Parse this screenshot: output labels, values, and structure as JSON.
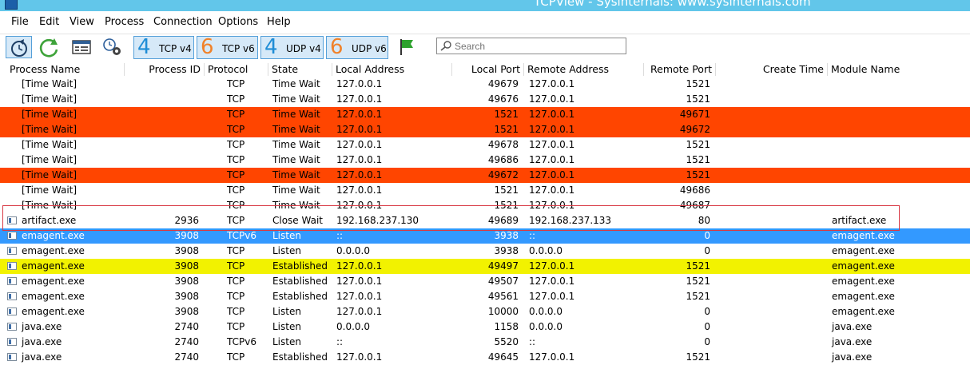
{
  "window": {
    "title": "TCPView - Sysinternals: www.sysinternals.com"
  },
  "menu": [
    "File",
    "Edit",
    "View",
    "Process",
    "Connection",
    "Options",
    "Help"
  ],
  "toolbar": {
    "protocols": [
      {
        "num": "4",
        "label": "TCP v4",
        "color": "#1f8dd6"
      },
      {
        "num": "6",
        "label": "TCP v6",
        "color": "#f0822a"
      },
      {
        "num": "4",
        "label": "UDP v4",
        "color": "#1f8dd6"
      },
      {
        "num": "6",
        "label": "UDP v6",
        "color": "#f0822a"
      }
    ]
  },
  "search": {
    "placeholder": "Search"
  },
  "columns": [
    "Process Name",
    "Process ID",
    "Protocol",
    "State",
    "Local Address",
    "Local Port",
    "Remote Address",
    "Remote Port",
    "Create Time",
    "Module Name"
  ],
  "colors": {
    "removed": "#ff4500",
    "new": "#3399ff",
    "changed": "#f2f200",
    "highlight_box": "#d83a45"
  },
  "rows": [
    {
      "name": "[Time Wait]",
      "pid": "",
      "proto": "TCP",
      "state": "Time Wait",
      "laddr": "127.0.0.1",
      "lport": "49679",
      "raddr": "127.0.0.1",
      "rport": "1521",
      "ctime": "",
      "module": "",
      "status": "normal",
      "icon": false
    },
    {
      "name": "[Time Wait]",
      "pid": "",
      "proto": "TCP",
      "state": "Time Wait",
      "laddr": "127.0.0.1",
      "lport": "49676",
      "raddr": "127.0.0.1",
      "rport": "1521",
      "ctime": "",
      "module": "",
      "status": "normal",
      "icon": false
    },
    {
      "name": "[Time Wait]",
      "pid": "",
      "proto": "TCP",
      "state": "Time Wait",
      "laddr": "127.0.0.1",
      "lport": "1521",
      "raddr": "127.0.0.1",
      "rport": "49671",
      "ctime": "",
      "module": "",
      "status": "removed",
      "icon": false
    },
    {
      "name": "[Time Wait]",
      "pid": "",
      "proto": "TCP",
      "state": "Time Wait",
      "laddr": "127.0.0.1",
      "lport": "1521",
      "raddr": "127.0.0.1",
      "rport": "49672",
      "ctime": "",
      "module": "",
      "status": "removed",
      "icon": false
    },
    {
      "name": "[Time Wait]",
      "pid": "",
      "proto": "TCP",
      "state": "Time Wait",
      "laddr": "127.0.0.1",
      "lport": "49678",
      "raddr": "127.0.0.1",
      "rport": "1521",
      "ctime": "",
      "module": "",
      "status": "normal",
      "icon": false
    },
    {
      "name": "[Time Wait]",
      "pid": "",
      "proto": "TCP",
      "state": "Time Wait",
      "laddr": "127.0.0.1",
      "lport": "49686",
      "raddr": "127.0.0.1",
      "rport": "1521",
      "ctime": "",
      "module": "",
      "status": "normal",
      "icon": false
    },
    {
      "name": "[Time Wait]",
      "pid": "",
      "proto": "TCP",
      "state": "Time Wait",
      "laddr": "127.0.0.1",
      "lport": "49672",
      "raddr": "127.0.0.1",
      "rport": "1521",
      "ctime": "",
      "module": "",
      "status": "removed",
      "icon": false
    },
    {
      "name": "[Time Wait]",
      "pid": "",
      "proto": "TCP",
      "state": "Time Wait",
      "laddr": "127.0.0.1",
      "lport": "1521",
      "raddr": "127.0.0.1",
      "rport": "49686",
      "ctime": "",
      "module": "",
      "status": "normal",
      "icon": false
    },
    {
      "name": "[Time Wait]",
      "pid": "",
      "proto": "TCP",
      "state": "Time Wait",
      "laddr": "127.0.0.1",
      "lport": "1521",
      "raddr": "127.0.0.1",
      "rport": "49687",
      "ctime": "",
      "module": "",
      "status": "normal",
      "icon": false
    },
    {
      "name": "artifact.exe",
      "pid": "2936",
      "proto": "TCP",
      "state": "Close Wait",
      "laddr": "192.168.237.130",
      "lport": "49689",
      "raddr": "192.168.237.133",
      "rport": "80",
      "ctime": "",
      "module": "artifact.exe",
      "status": "normal",
      "icon": true
    },
    {
      "name": "emagent.exe",
      "pid": "3908",
      "proto": "TCPv6",
      "state": "Listen",
      "laddr": "::",
      "lport": "3938",
      "raddr": "::",
      "rport": "0",
      "ctime": "",
      "module": "emagent.exe",
      "status": "new",
      "icon": true
    },
    {
      "name": "emagent.exe",
      "pid": "3908",
      "proto": "TCP",
      "state": "Listen",
      "laddr": "0.0.0.0",
      "lport": "3938",
      "raddr": "0.0.0.0",
      "rport": "0",
      "ctime": "",
      "module": "emagent.exe",
      "status": "normal",
      "icon": true
    },
    {
      "name": "emagent.exe",
      "pid": "3908",
      "proto": "TCP",
      "state": "Established",
      "laddr": "127.0.0.1",
      "lport": "49497",
      "raddr": "127.0.0.1",
      "rport": "1521",
      "ctime": "",
      "module": "emagent.exe",
      "status": "changed",
      "icon": true
    },
    {
      "name": "emagent.exe",
      "pid": "3908",
      "proto": "TCP",
      "state": "Established",
      "laddr": "127.0.0.1",
      "lport": "49507",
      "raddr": "127.0.0.1",
      "rport": "1521",
      "ctime": "",
      "module": "emagent.exe",
      "status": "normal",
      "icon": true
    },
    {
      "name": "emagent.exe",
      "pid": "3908",
      "proto": "TCP",
      "state": "Established",
      "laddr": "127.0.0.1",
      "lport": "49561",
      "raddr": "127.0.0.1",
      "rport": "1521",
      "ctime": "",
      "module": "emagent.exe",
      "status": "normal",
      "icon": true
    },
    {
      "name": "emagent.exe",
      "pid": "3908",
      "proto": "TCP",
      "state": "Listen",
      "laddr": "127.0.0.1",
      "lport": "10000",
      "raddr": "0.0.0.0",
      "rport": "0",
      "ctime": "",
      "module": "emagent.exe",
      "status": "normal",
      "icon": true
    },
    {
      "name": "java.exe",
      "pid": "2740",
      "proto": "TCP",
      "state": "Listen",
      "laddr": "0.0.0.0",
      "lport": "1158",
      "raddr": "0.0.0.0",
      "rport": "0",
      "ctime": "",
      "module": "java.exe",
      "status": "normal",
      "icon": true
    },
    {
      "name": "java.exe",
      "pid": "2740",
      "proto": "TCPv6",
      "state": "Listen",
      "laddr": "::",
      "lport": "5520",
      "raddr": "::",
      "rport": "0",
      "ctime": "",
      "module": "java.exe",
      "status": "normal",
      "icon": true
    },
    {
      "name": "java.exe",
      "pid": "2740",
      "proto": "TCP",
      "state": "Established",
      "laddr": "127.0.0.1",
      "lport": "49645",
      "raddr": "127.0.0.1",
      "rport": "1521",
      "ctime": "",
      "module": "java.exe",
      "status": "normal",
      "icon": true
    }
  ]
}
